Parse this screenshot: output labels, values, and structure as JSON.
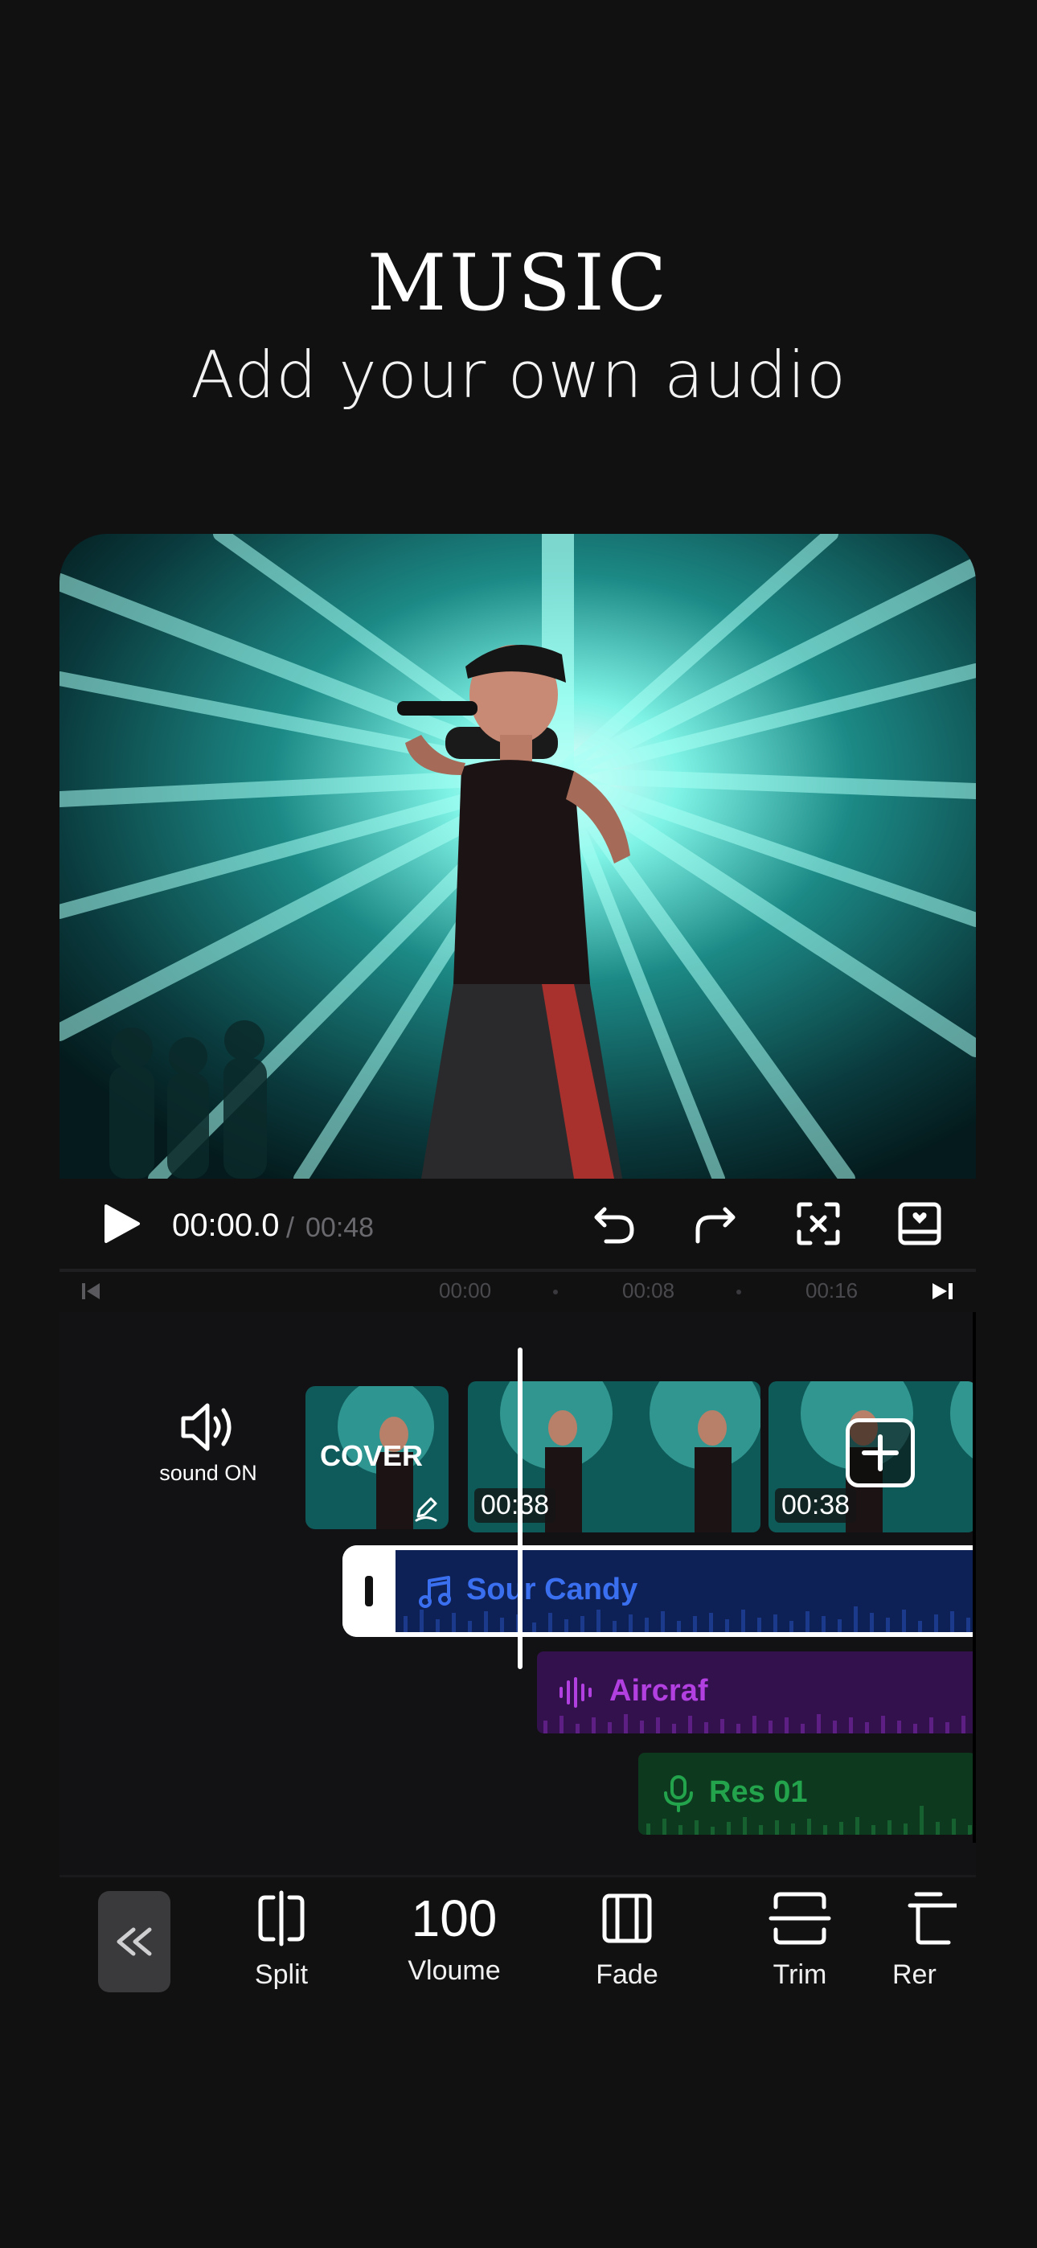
{
  "header": {
    "title": "MUSIC",
    "subtitle": "Add your own audio"
  },
  "player": {
    "current_time": "00:00.0",
    "separator": "/",
    "total_time": "00:48"
  },
  "ruler": {
    "ticks": [
      "00:00",
      "00:08",
      "00:16"
    ]
  },
  "timeline": {
    "sound_label": "sound ON",
    "cover_label": "COVER",
    "clips": [
      {
        "duration": "00:38"
      },
      {
        "duration": "00:38"
      }
    ],
    "audio_tracks": [
      {
        "label": "Sour Candy",
        "color": "#3a6ff0",
        "bg": "#0d2157"
      },
      {
        "label": "Aircraf",
        "color": "#b23fe0",
        "bg": "#33114d"
      },
      {
        "label": "Res 01",
        "color": "#23a34c",
        "bg": "#0d3a1e"
      }
    ]
  },
  "toolbar": {
    "tools": [
      {
        "label": "Split"
      },
      {
        "label": "Vloume",
        "value": "100"
      },
      {
        "label": "Fade"
      },
      {
        "label": "Trim"
      },
      {
        "label": "Rer"
      }
    ]
  }
}
